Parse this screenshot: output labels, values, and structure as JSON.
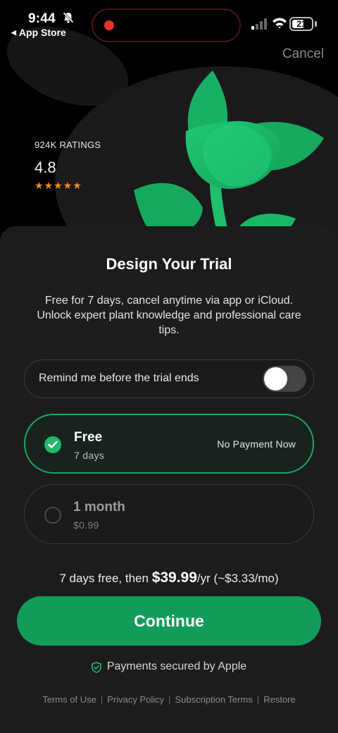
{
  "status_bar": {
    "time": "9:44",
    "back_app": "App Store",
    "battery": "21"
  },
  "header": {
    "cancel_label": "Cancel"
  },
  "ratings": {
    "label": "924K RATINGS",
    "score": "4.8",
    "stars": "★★★★★",
    "star_count": 5,
    "star_color": "#f08a24"
  },
  "sheet": {
    "title": "Design Your Trial",
    "subtitle": "Free for 7 days, cancel anytime via app or iCloud. Unlock expert plant knowledge and professional care tips.",
    "reminder": {
      "label": "Remind me before the trial ends",
      "enabled": false
    },
    "plans": [
      {
        "name": "Free",
        "sub": "7 days",
        "badge": "No Payment Now",
        "selected": true
      },
      {
        "name": "1 month",
        "sub": "$0.99",
        "selected": false
      }
    ],
    "price_line": {
      "prefix": "7 days free, then ",
      "price": "$39.99",
      "suffix": "/yr (~$3.33/mo)"
    },
    "continue_label": "Continue",
    "secure_label": "Payments secured by Apple",
    "footer_links": [
      "Terms of Use",
      "Privacy Policy",
      "Subscription Terms",
      "Restore"
    ]
  },
  "colors": {
    "accent": "#119c5a",
    "selected_border": "#1ea664",
    "plant_green": "#1fc070",
    "background": "#1c1c1c"
  }
}
